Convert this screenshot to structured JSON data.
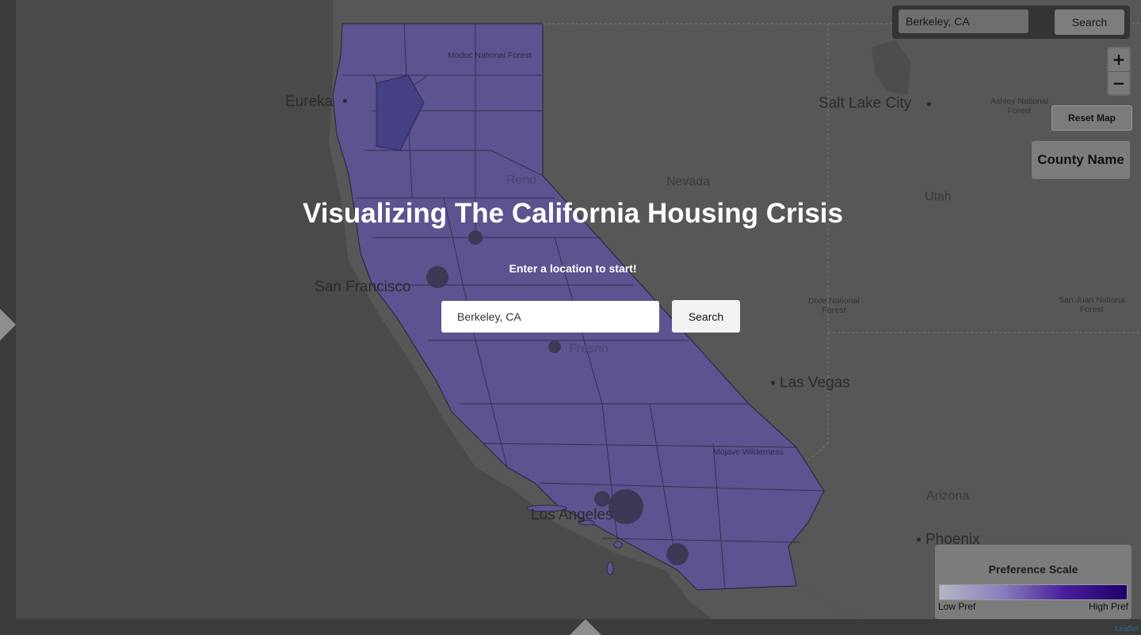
{
  "page": {
    "title": "Visualizing The California Housing Crisis",
    "subtitle": "Enter a location to start!"
  },
  "main_search": {
    "input_value": "Berkeley, CA",
    "button_label": "Search"
  },
  "top_search": {
    "input_value": "Berkeley, CA",
    "button_label": "Search"
  },
  "map_controls": {
    "zoom_in": "+",
    "zoom_out": "−",
    "reset_label": "Reset Map",
    "county_label": "County Name"
  },
  "legend": {
    "title": "Preference Scale",
    "low_label": "Low Pref",
    "high_label": "High Pref",
    "colors": [
      "#b4b6c6",
      "#8a7fbd",
      "#4a1d9a",
      "#1e0068"
    ]
  },
  "map_labels": {
    "eureka": "Eureka",
    "salt_lake_city": "Salt Lake City",
    "nevada": "Nevada",
    "utah": "Utah",
    "san_francisco": "San Francisco",
    "las_vegas": "Las Vegas",
    "los_angeles": "Los Angeles",
    "arizona": "Arizona",
    "phoenix": "Phoenix",
    "reno": "Reno",
    "fresno": "Fresno",
    "modoc": "Modoc National Forest",
    "ashley": [
      "Ashley National",
      "Forest"
    ],
    "dixie": [
      "Dixie National",
      "Forest"
    ],
    "san_juan": [
      "San Juan Nationa",
      "Forest"
    ],
    "mojave": "Mojave Wilderness"
  },
  "attribution": "Leaflet",
  "colors": {
    "overlay": "#4a4a4a",
    "california_fill": "#5b5490",
    "accent": "#1e0068"
  }
}
